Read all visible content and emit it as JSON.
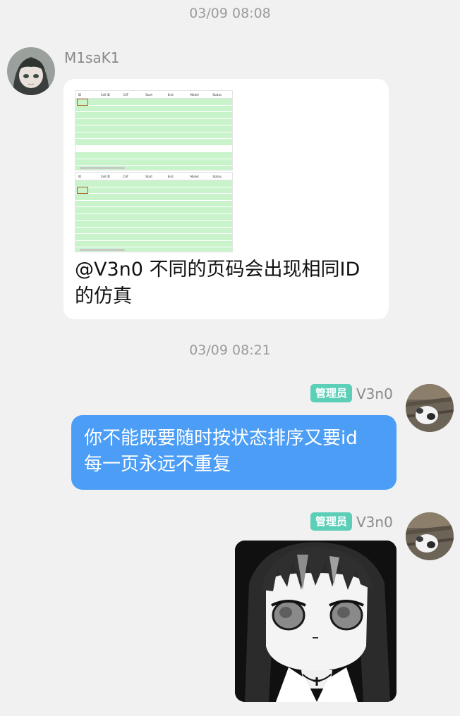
{
  "timestamps": [
    "03/09 08:08",
    "03/09 08:21"
  ],
  "messages": [
    {
      "sender": "M1saK1",
      "side": "left",
      "attachment": "screenshot",
      "text_line1": "@V3n0 不同的页码会出现相同ID",
      "text_line2": "的仿真"
    },
    {
      "sender": "V3n0",
      "badge": "管理员",
      "side": "right",
      "text_line1": "你不能既要随时按状态排序又要id",
      "text_line2": "每一页永远不重复"
    },
    {
      "sender": "V3n0",
      "badge": "管理员",
      "side": "right",
      "attachment": "anime-girl-sticker"
    }
  ],
  "colors": {
    "background": "#f1f1f1",
    "bubble_left": "#ffffff",
    "bubble_right": "#4b9df5",
    "badge": "#5ccfb8",
    "row_highlight": "#c9f4cb"
  }
}
